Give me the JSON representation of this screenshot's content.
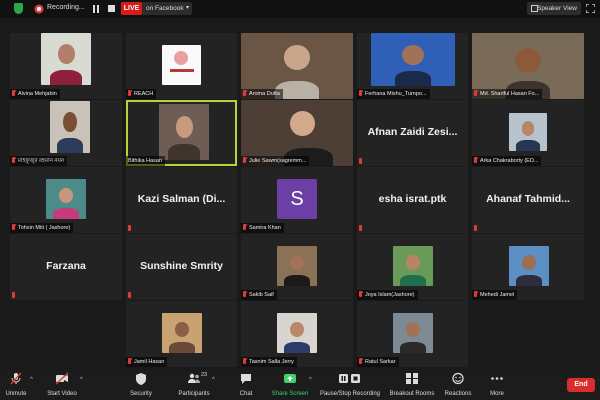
{
  "topbar": {
    "recording_text": "Recording...",
    "live_label": "LIVE",
    "live_destination": "on Facebook",
    "speaker_view_label": "Speaker View"
  },
  "participants": {
    "alvina": "Alvina Mehjabin",
    "reach": "REACH",
    "aroma": "Aroma Dutta",
    "ferhana": "Ferhana Mishu_Turnpo...",
    "shariful": "Md. Shariful Hasan Fo...",
    "bangla": "মাহফুজুর রহমান নয়ন",
    "bithika": "Bithika Hasan",
    "julie": "Julie Sawm(sagremm...",
    "afnan": "Afnan Zaidi Zesi...",
    "arka": "Arka Chakraborty (ED...",
    "tohsin": "Tohsin Miti ( Jashore)",
    "kazi": "Kazi Salman (Di...",
    "samira": "Samira Khan",
    "samira_initial": "S",
    "esha": "esha israt.ptk",
    "ahanaf": "Ahanaf Tahmid...",
    "farzana": "Farzana",
    "sunshine": "Sunshine Smrity",
    "sakib": "Sakib Saif",
    "joya": "Joya Islam(Jashore)",
    "mehedi": "Mehedi Jamel",
    "jamil": "Jamil Hasan",
    "tasnim": "Tasnim Salla Jerry",
    "ratul": "Ratul Sarkar"
  },
  "toolbar": {
    "unmute": "Unmute",
    "start_video": "Start Video",
    "security": "Security",
    "participants": "Participants",
    "participants_count": "23",
    "chat": "Chat",
    "share_screen": "Share Screen",
    "pause_stop": "Pause/Stop Recording",
    "breakout": "Breakout Rooms",
    "reactions": "Reactions",
    "more": "More",
    "end": "End"
  },
  "colors": {
    "active_speaker_border": "#b6d43a",
    "share_screen_green": "#3fd16b",
    "end_red": "#d92c2c",
    "live_red": "#d91a1a",
    "avatar_purple": "#6b3fa6"
  }
}
